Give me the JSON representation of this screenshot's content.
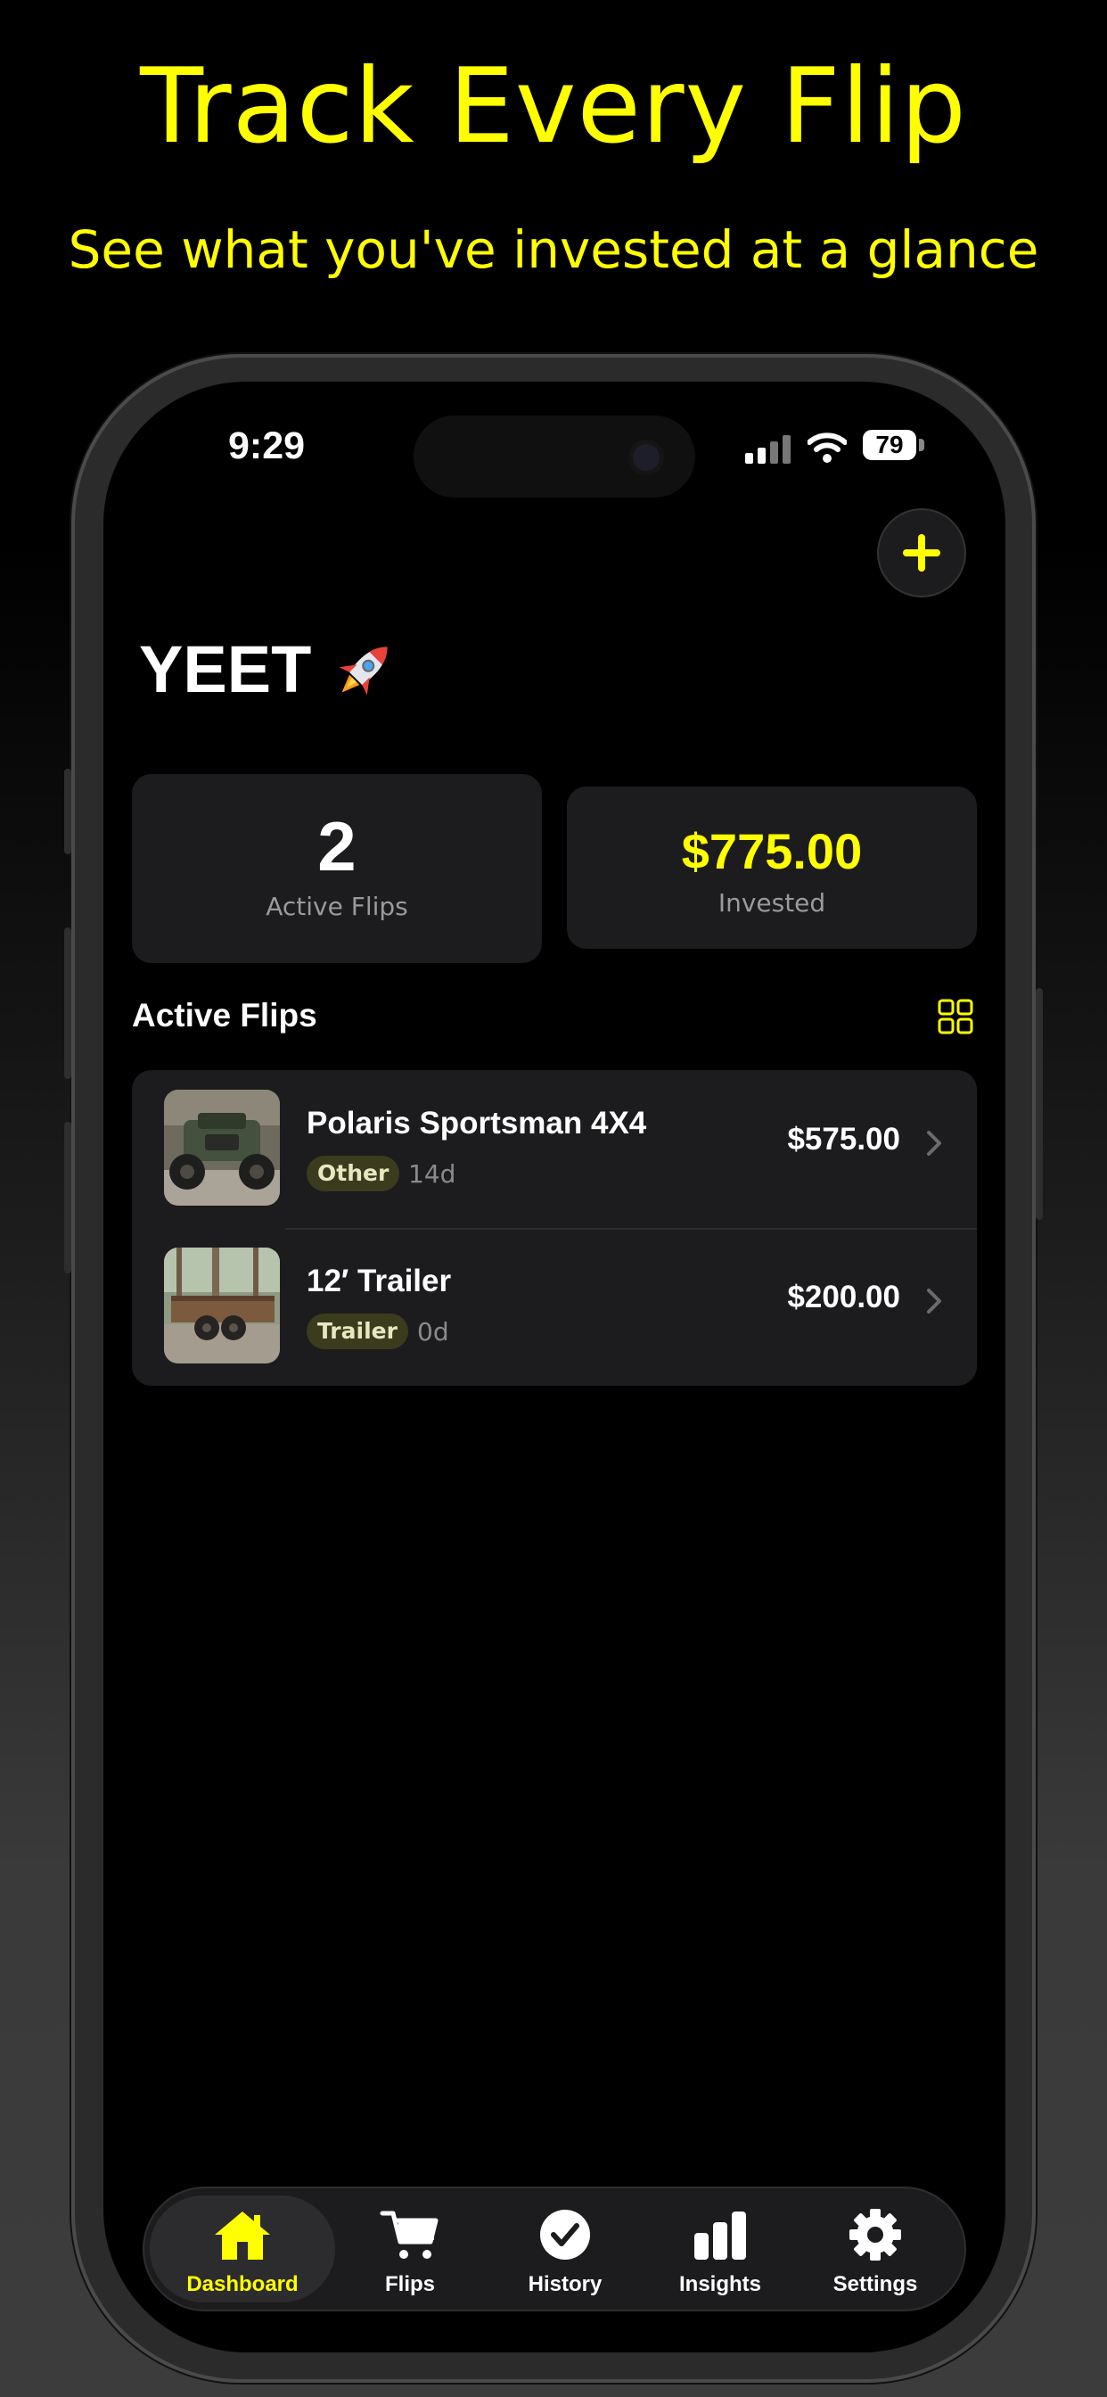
{
  "promo": {
    "title": "Track Every Flip",
    "subtitle": "See what you've invested at a glance"
  },
  "status_bar": {
    "time": "9:29",
    "battery": "79"
  },
  "header": {
    "app_title": "YEET",
    "title_icon": "rocket-icon",
    "add_icon": "plus-icon"
  },
  "stats": {
    "active_count": "2",
    "active_label": "Active Flips",
    "invested_value": "$775.00",
    "invested_label": "Invested"
  },
  "section": {
    "title": "Active Flips",
    "view_toggle_icon": "grid-icon"
  },
  "flips": [
    {
      "name": "Polaris Sportsman 4X4",
      "tag": "Other",
      "age": "14d",
      "price": "$575.00"
    },
    {
      "name": "12′ Trailer",
      "tag": "Trailer",
      "age": "0d",
      "price": "$200.00"
    }
  ],
  "tabs": [
    {
      "label": "Dashboard",
      "icon": "home-icon",
      "active": true
    },
    {
      "label": "Flips",
      "icon": "cart-icon",
      "active": false
    },
    {
      "label": "History",
      "icon": "checkmark-circle-icon",
      "active": false
    },
    {
      "label": "Insights",
      "icon": "bar-chart-icon",
      "active": false
    },
    {
      "label": "Settings",
      "icon": "gear-icon",
      "active": false
    }
  ],
  "colors": {
    "accent": "#ffff00",
    "background": "#000000",
    "card": "#1c1c1e"
  }
}
